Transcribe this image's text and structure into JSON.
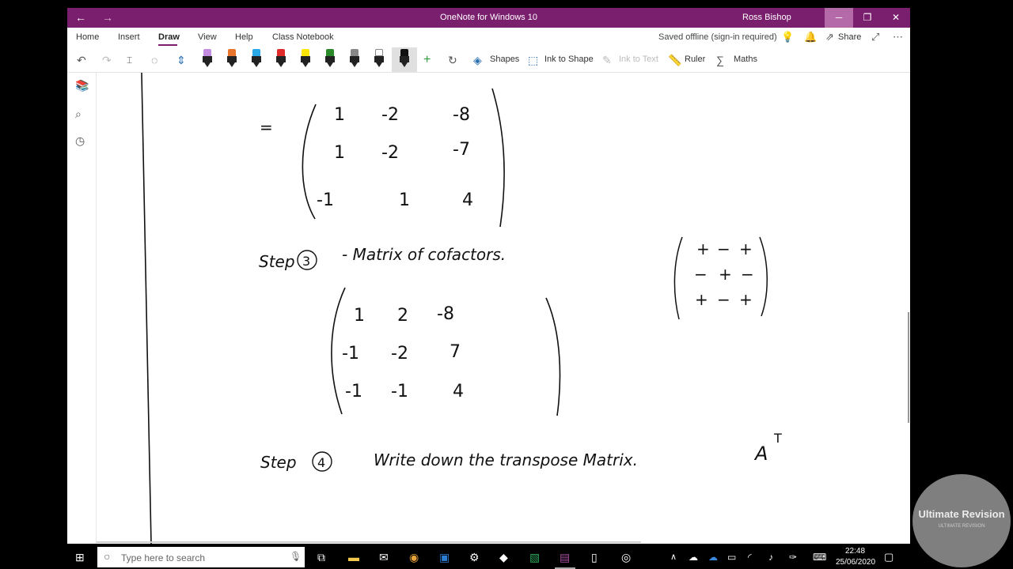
{
  "window": {
    "title": "OneNote for Windows 10",
    "user": "Ross Bishop",
    "controls": {
      "minimize": "─",
      "maximize": "❐",
      "close": "✕"
    },
    "accent": "#7a1e6e"
  },
  "menu": {
    "tabs": [
      "Home",
      "Insert",
      "Draw",
      "View",
      "Help",
      "Class Notebook"
    ],
    "active_tab": "Draw",
    "saved_status": "Saved offline (sign-in required)",
    "share_label": "Share"
  },
  "toolbar": {
    "pens": [
      {
        "color": "#c48be0"
      },
      {
        "color": "#e8732a"
      },
      {
        "color": "#2aa9e8"
      },
      {
        "color": "#e02a2a"
      },
      {
        "color": "#ffe600"
      },
      {
        "color": "#2a8a2a"
      },
      {
        "color": "#888888"
      },
      {
        "color": "#ffffff"
      },
      {
        "color": "#111111"
      }
    ],
    "shapes_label": "Shapes",
    "ink_to_shape_label": "Ink to Shape",
    "ink_to_text_label": "Ink to Text",
    "ruler_label": "Ruler",
    "maths_label": "Maths"
  },
  "page": {
    "equals": "=",
    "matrix1": [
      [
        "1",
        "-2",
        "-8"
      ],
      [
        "1",
        "-2",
        "-7"
      ],
      [
        "-1",
        "1",
        "4"
      ]
    ],
    "step3": {
      "prefix": "Step",
      "number": "3",
      "text": "- Matrix of cofactors."
    },
    "sign_matrix": [
      [
        "+",
        "−",
        "+"
      ],
      [
        "−",
        "+",
        "−"
      ],
      [
        "+",
        "−",
        "+"
      ]
    ],
    "matrix2": [
      [
        "1",
        "2",
        "-8"
      ],
      [
        "-1",
        "-2",
        "7"
      ],
      [
        "-1",
        "-1",
        "4"
      ]
    ],
    "step4": {
      "prefix": "Step",
      "number": "4",
      "text": "Write down the transpose Matrix.",
      "math": "A",
      "sup": "T"
    }
  },
  "taskbar": {
    "search_placeholder": "Type here to search",
    "time": "22:48",
    "date": "25/06/2020"
  },
  "watermark": {
    "title": "Ultimate Revision",
    "subtitle": "ULTIMATE REVISION"
  }
}
